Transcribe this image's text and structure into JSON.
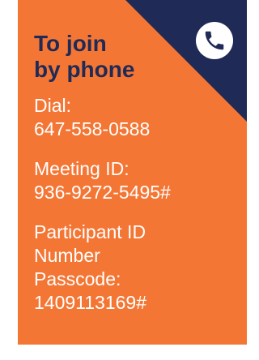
{
  "card": {
    "heading_line1": "To join",
    "heading_line2": "by phone",
    "dial_label": "Dial:",
    "dial_number": "647-558-0588",
    "meeting_label": "Meeting ID:",
    "meeting_id": "936-9272-5495#",
    "participant_line1": "Participant ID",
    "participant_line2": "Number",
    "passcode_label": "Passcode:",
    "passcode_value": "1409113169#"
  },
  "colors": {
    "background": "#f47634",
    "corner": "#1f2a56",
    "heading": "#1f2a56",
    "text": "#ffffff"
  },
  "icons": {
    "phone": "phone-icon"
  }
}
